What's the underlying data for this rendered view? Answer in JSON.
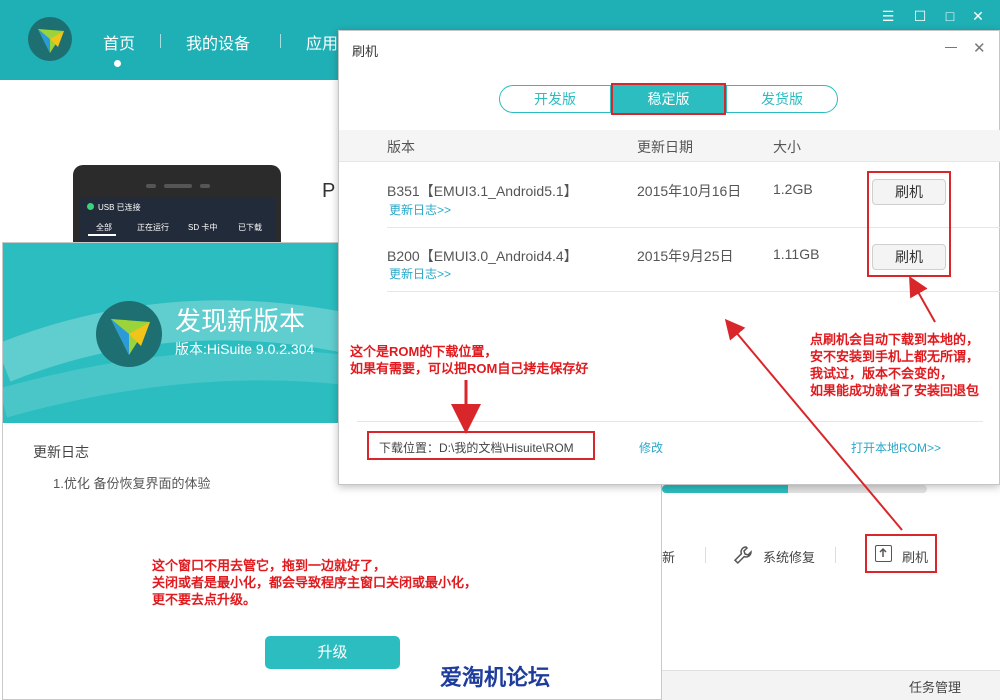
{
  "main": {
    "nav": [
      "首页",
      "我的设备",
      "应用"
    ],
    "phone": {
      "usb": "USB 已连接",
      "tabs": [
        "全部",
        "正在运行",
        "SD 卡中",
        "已下载"
      ],
      "partial": "P"
    },
    "tools": {
      "update_partial": "新",
      "repair": "系统修复",
      "flash": "刷机"
    },
    "task": "任务管理",
    "win_controls": [
      "☰",
      "☐",
      "□",
      "✕"
    ]
  },
  "update_dialog": {
    "title": "发现新版本",
    "version": "版本:HiSuite 9.0.2.304",
    "changelog_heading": "更新日志",
    "changelog_item": "1.优化 备份恢复界面的体验",
    "upgrade_button": "升级"
  },
  "flash_dialog": {
    "title": "刷机",
    "tabs": [
      "开发版",
      "稳定版",
      "发货版"
    ],
    "active_tab": "稳定版",
    "columns": [
      "版本",
      "更新日期",
      "大小"
    ],
    "rows": [
      {
        "version": "B351【EMUI3.1_Android5.1】",
        "date": "2015年10月16日",
        "size": "1.2GB",
        "log": "更新日志>>",
        "button": "刷机"
      },
      {
        "version": "B200【EMUI3.0_Android4.4】",
        "date": "2015年9月25日",
        "size": "1.11GB",
        "log": "更新日志>>",
        "button": "刷机"
      }
    ],
    "download_location": "下载位置：D:\\我的文档\\Hisuite\\ROM",
    "modify": "修改",
    "open_local": "打开本地ROM>>"
  },
  "annotations": {
    "rom_location": [
      "这个是ROM的下载位置，",
      "如果有需要，可以把ROM自己拷走保存好"
    ],
    "flash_note": [
      "点刷机会自动下载到本地的，",
      "安不安装到手机上都无所谓，",
      "我试过，版本不会变的，",
      "如果能成功就省了安装回退包"
    ],
    "window_note": [
      "这个窗口不用去管它，拖到一边就好了，",
      "关闭或者是最小化，都会导致程序主窗口关闭或最小化，",
      "更不要去点升级。"
    ]
  },
  "watermark": "爱淘机论坛",
  "colors": {
    "accent": "#2bbdbf",
    "header": "#1fb0b5",
    "annotation": "#e01a1e",
    "link": "#2aa8c9"
  }
}
